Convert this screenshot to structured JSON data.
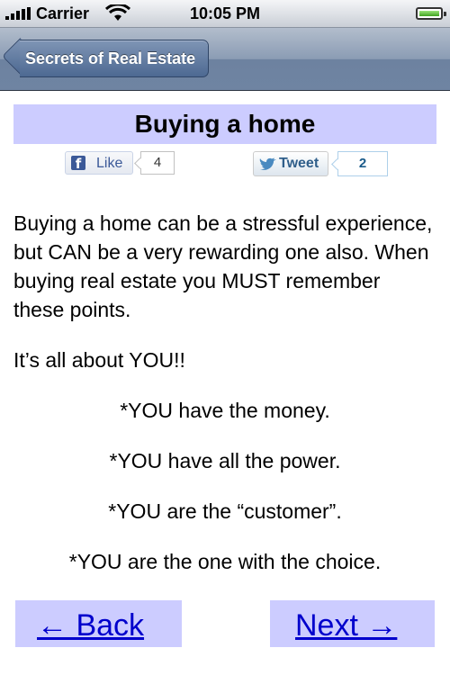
{
  "status_bar": {
    "carrier": "Carrier",
    "time": "10:05 PM",
    "battery_level": 1.0
  },
  "nav_bar": {
    "back_label": "Secrets of Real Estate"
  },
  "article": {
    "title": "Buying a home",
    "like": {
      "label": "Like",
      "count": "4"
    },
    "tweet": {
      "label": "Tweet",
      "count": "2"
    },
    "intro": "Buying a home can be a stressful experience, but CAN be a very rewarding one also. When buying real estate you MUST remember these points.",
    "about": "It’s all about YOU!!",
    "points": [
      "*YOU have the money.",
      "*YOU have all the power.",
      "*YOU are the “customer”.",
      "*YOU are the one with the choice."
    ]
  },
  "pager": {
    "back_label": "← Back",
    "next_label": "Next →"
  },
  "colors": {
    "title_bg": "#ccccff",
    "link": "#0000cc",
    "nav_bar": "#6d82a0",
    "facebook": "#3b5998"
  },
  "icons": [
    "signal-bars-icon",
    "wifi-icon",
    "battery-icon",
    "facebook-icon",
    "twitter-bird-icon",
    "back-chevron-icon"
  ]
}
